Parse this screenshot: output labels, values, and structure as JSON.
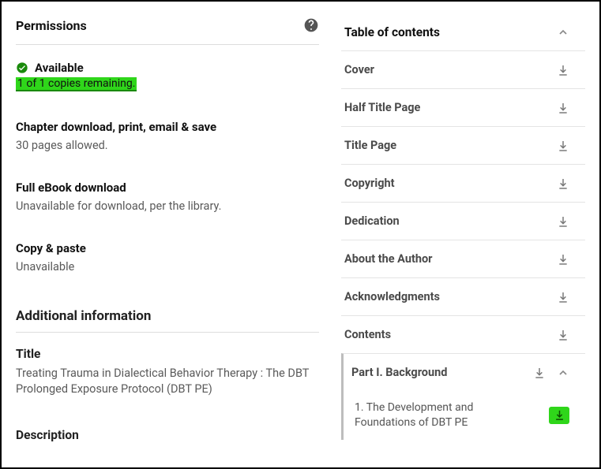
{
  "permissions": {
    "heading": "Permissions",
    "available_label": "Available",
    "copies_remaining": "1 of 1 copies remaining.",
    "chapter": {
      "heading": "Chapter download, print, email & save",
      "detail": "30 pages allowed."
    },
    "full_ebook": {
      "heading": "Full eBook download",
      "detail": "Unavailable for download, per the library."
    },
    "copy_paste": {
      "heading": "Copy & paste",
      "detail": "Unavailable"
    }
  },
  "additional_info": {
    "heading": "Additional information",
    "title_label": "Title",
    "title_value": "Treating Trauma in Dialectical Behavior Therapy : The DBT Prolonged Exposure Protocol (DBT PE)",
    "description_label": "Description"
  },
  "toc": {
    "heading": "Table of contents",
    "items": [
      {
        "label": "Cover"
      },
      {
        "label": "Half Title Page"
      },
      {
        "label": "Title Page"
      },
      {
        "label": "Copyright"
      },
      {
        "label": "Dedication"
      },
      {
        "label": "About the Author"
      },
      {
        "label": "Acknowledgments"
      },
      {
        "label": "Contents"
      }
    ],
    "part": {
      "label": "Part I. Background",
      "children": [
        {
          "label": "1. The Development and Foundations of DBT PE"
        }
      ]
    }
  }
}
